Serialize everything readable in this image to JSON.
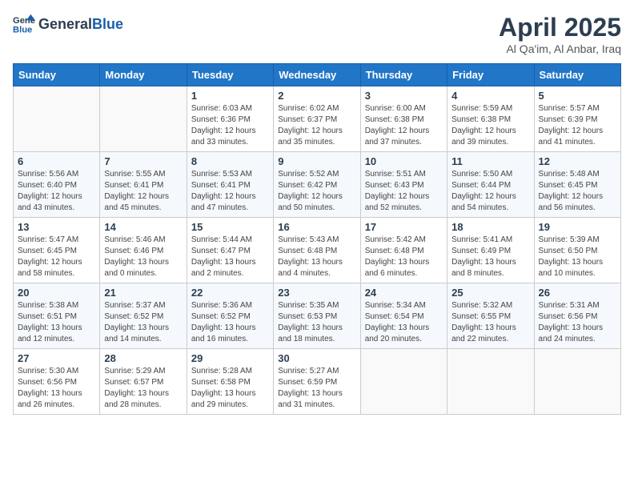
{
  "header": {
    "logo_general": "General",
    "logo_blue": "Blue",
    "month_year": "April 2025",
    "location": "Al Qa'im, Al Anbar, Iraq"
  },
  "days_of_week": [
    "Sunday",
    "Monday",
    "Tuesday",
    "Wednesday",
    "Thursday",
    "Friday",
    "Saturday"
  ],
  "weeks": [
    [
      {
        "day": "",
        "sunrise": "",
        "sunset": "",
        "daylight": ""
      },
      {
        "day": "",
        "sunrise": "",
        "sunset": "",
        "daylight": ""
      },
      {
        "day": "1",
        "sunrise": "Sunrise: 6:03 AM",
        "sunset": "Sunset: 6:36 PM",
        "daylight": "Daylight: 12 hours and 33 minutes."
      },
      {
        "day": "2",
        "sunrise": "Sunrise: 6:02 AM",
        "sunset": "Sunset: 6:37 PM",
        "daylight": "Daylight: 12 hours and 35 minutes."
      },
      {
        "day": "3",
        "sunrise": "Sunrise: 6:00 AM",
        "sunset": "Sunset: 6:38 PM",
        "daylight": "Daylight: 12 hours and 37 minutes."
      },
      {
        "day": "4",
        "sunrise": "Sunrise: 5:59 AM",
        "sunset": "Sunset: 6:38 PM",
        "daylight": "Daylight: 12 hours and 39 minutes."
      },
      {
        "day": "5",
        "sunrise": "Sunrise: 5:57 AM",
        "sunset": "Sunset: 6:39 PM",
        "daylight": "Daylight: 12 hours and 41 minutes."
      }
    ],
    [
      {
        "day": "6",
        "sunrise": "Sunrise: 5:56 AM",
        "sunset": "Sunset: 6:40 PM",
        "daylight": "Daylight: 12 hours and 43 minutes."
      },
      {
        "day": "7",
        "sunrise": "Sunrise: 5:55 AM",
        "sunset": "Sunset: 6:41 PM",
        "daylight": "Daylight: 12 hours and 45 minutes."
      },
      {
        "day": "8",
        "sunrise": "Sunrise: 5:53 AM",
        "sunset": "Sunset: 6:41 PM",
        "daylight": "Daylight: 12 hours and 47 minutes."
      },
      {
        "day": "9",
        "sunrise": "Sunrise: 5:52 AM",
        "sunset": "Sunset: 6:42 PM",
        "daylight": "Daylight: 12 hours and 50 minutes."
      },
      {
        "day": "10",
        "sunrise": "Sunrise: 5:51 AM",
        "sunset": "Sunset: 6:43 PM",
        "daylight": "Daylight: 12 hours and 52 minutes."
      },
      {
        "day": "11",
        "sunrise": "Sunrise: 5:50 AM",
        "sunset": "Sunset: 6:44 PM",
        "daylight": "Daylight: 12 hours and 54 minutes."
      },
      {
        "day": "12",
        "sunrise": "Sunrise: 5:48 AM",
        "sunset": "Sunset: 6:45 PM",
        "daylight": "Daylight: 12 hours and 56 minutes."
      }
    ],
    [
      {
        "day": "13",
        "sunrise": "Sunrise: 5:47 AM",
        "sunset": "Sunset: 6:45 PM",
        "daylight": "Daylight: 12 hours and 58 minutes."
      },
      {
        "day": "14",
        "sunrise": "Sunrise: 5:46 AM",
        "sunset": "Sunset: 6:46 PM",
        "daylight": "Daylight: 13 hours and 0 minutes."
      },
      {
        "day": "15",
        "sunrise": "Sunrise: 5:44 AM",
        "sunset": "Sunset: 6:47 PM",
        "daylight": "Daylight: 13 hours and 2 minutes."
      },
      {
        "day": "16",
        "sunrise": "Sunrise: 5:43 AM",
        "sunset": "Sunset: 6:48 PM",
        "daylight": "Daylight: 13 hours and 4 minutes."
      },
      {
        "day": "17",
        "sunrise": "Sunrise: 5:42 AM",
        "sunset": "Sunset: 6:48 PM",
        "daylight": "Daylight: 13 hours and 6 minutes."
      },
      {
        "day": "18",
        "sunrise": "Sunrise: 5:41 AM",
        "sunset": "Sunset: 6:49 PM",
        "daylight": "Daylight: 13 hours and 8 minutes."
      },
      {
        "day": "19",
        "sunrise": "Sunrise: 5:39 AM",
        "sunset": "Sunset: 6:50 PM",
        "daylight": "Daylight: 13 hours and 10 minutes."
      }
    ],
    [
      {
        "day": "20",
        "sunrise": "Sunrise: 5:38 AM",
        "sunset": "Sunset: 6:51 PM",
        "daylight": "Daylight: 13 hours and 12 minutes."
      },
      {
        "day": "21",
        "sunrise": "Sunrise: 5:37 AM",
        "sunset": "Sunset: 6:52 PM",
        "daylight": "Daylight: 13 hours and 14 minutes."
      },
      {
        "day": "22",
        "sunrise": "Sunrise: 5:36 AM",
        "sunset": "Sunset: 6:52 PM",
        "daylight": "Daylight: 13 hours and 16 minutes."
      },
      {
        "day": "23",
        "sunrise": "Sunrise: 5:35 AM",
        "sunset": "Sunset: 6:53 PM",
        "daylight": "Daylight: 13 hours and 18 minutes."
      },
      {
        "day": "24",
        "sunrise": "Sunrise: 5:34 AM",
        "sunset": "Sunset: 6:54 PM",
        "daylight": "Daylight: 13 hours and 20 minutes."
      },
      {
        "day": "25",
        "sunrise": "Sunrise: 5:32 AM",
        "sunset": "Sunset: 6:55 PM",
        "daylight": "Daylight: 13 hours and 22 minutes."
      },
      {
        "day": "26",
        "sunrise": "Sunrise: 5:31 AM",
        "sunset": "Sunset: 6:56 PM",
        "daylight": "Daylight: 13 hours and 24 minutes."
      }
    ],
    [
      {
        "day": "27",
        "sunrise": "Sunrise: 5:30 AM",
        "sunset": "Sunset: 6:56 PM",
        "daylight": "Daylight: 13 hours and 26 minutes."
      },
      {
        "day": "28",
        "sunrise": "Sunrise: 5:29 AM",
        "sunset": "Sunset: 6:57 PM",
        "daylight": "Daylight: 13 hours and 28 minutes."
      },
      {
        "day": "29",
        "sunrise": "Sunrise: 5:28 AM",
        "sunset": "Sunset: 6:58 PM",
        "daylight": "Daylight: 13 hours and 29 minutes."
      },
      {
        "day": "30",
        "sunrise": "Sunrise: 5:27 AM",
        "sunset": "Sunset: 6:59 PM",
        "daylight": "Daylight: 13 hours and 31 minutes."
      },
      {
        "day": "",
        "sunrise": "",
        "sunset": "",
        "daylight": ""
      },
      {
        "day": "",
        "sunrise": "",
        "sunset": "",
        "daylight": ""
      },
      {
        "day": "",
        "sunrise": "",
        "sunset": "",
        "daylight": ""
      }
    ]
  ]
}
